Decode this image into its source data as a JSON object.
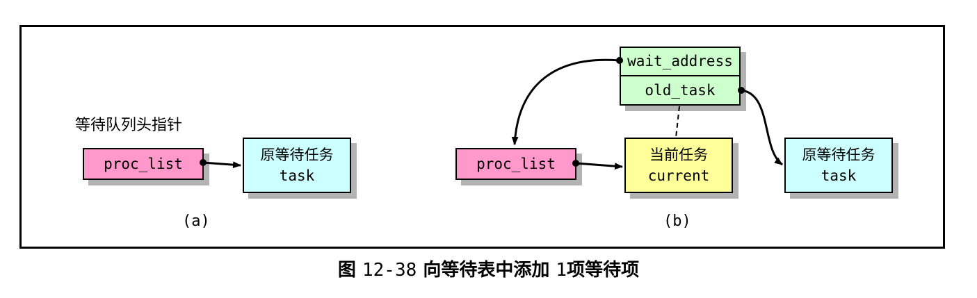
{
  "diagram_a": {
    "header_label": "等待队列头指针",
    "proc_list_label": "proc_list",
    "task_box": {
      "line1": "原等待任务",
      "line2": "task"
    },
    "caption": "(a)"
  },
  "diagram_b": {
    "proc_list_label": "proc_list",
    "current_box": {
      "line1": "当前任务",
      "line2": "current"
    },
    "wait_struct": {
      "field1": "wait_address",
      "field2": "old_task"
    },
    "task_box": {
      "line1": "原等待任务",
      "line2": "task"
    },
    "caption": "(b)"
  },
  "figure_caption": {
    "prefix": "图",
    "number": "12-38",
    "text_a": "向等待表中添加",
    "count": "1",
    "text_b": "项等待项"
  },
  "colors": {
    "proc_list": "#ff99cc",
    "task": "#ccffff",
    "current": "#ffff99",
    "wait_struct": "#ccffcc",
    "shadow": "#b3b3b3"
  }
}
